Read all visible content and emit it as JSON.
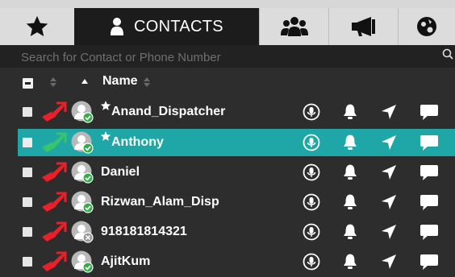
{
  "tabs": [
    {
      "id": "favorites",
      "icon": "star-icon"
    },
    {
      "id": "contacts",
      "label": "CONTACTS",
      "icon": "person-icon"
    },
    {
      "id": "groups",
      "icon": "group-icon"
    },
    {
      "id": "broadcast",
      "icon": "megaphone-icon"
    },
    {
      "id": "globe",
      "icon": "globe-icon"
    }
  ],
  "contacts_tab_label": "CONTACTS",
  "search": {
    "placeholder": "Search for Contact or Phone Number"
  },
  "table_header": {
    "name_label": "Name"
  },
  "contacts": [
    {
      "name": "Anand_Dispatcher",
      "starred": true,
      "status": "online",
      "arrow_color": "#e8202a",
      "selected": false
    },
    {
      "name": "Anthony",
      "starred": true,
      "status": "online",
      "arrow_color": "#38c46a",
      "selected": true
    },
    {
      "name": "Daniel",
      "starred": false,
      "status": "online",
      "arrow_color": "#e8202a",
      "selected": false
    },
    {
      "name": "Rizwan_Alam_Disp",
      "starred": false,
      "status": "online",
      "arrow_color": "#e8202a",
      "selected": false
    },
    {
      "name": "918181814321",
      "starred": false,
      "status": "offline",
      "arrow_color": "#e8202a",
      "selected": false
    },
    {
      "name": "AjitKum",
      "starred": false,
      "status": "online",
      "arrow_color": "#e8202a",
      "selected": false
    }
  ],
  "colors": {
    "accent": "#1fa6a6",
    "online": "#2fae4a",
    "offline": "#9a9a9a",
    "background": "#2d2d2d"
  }
}
